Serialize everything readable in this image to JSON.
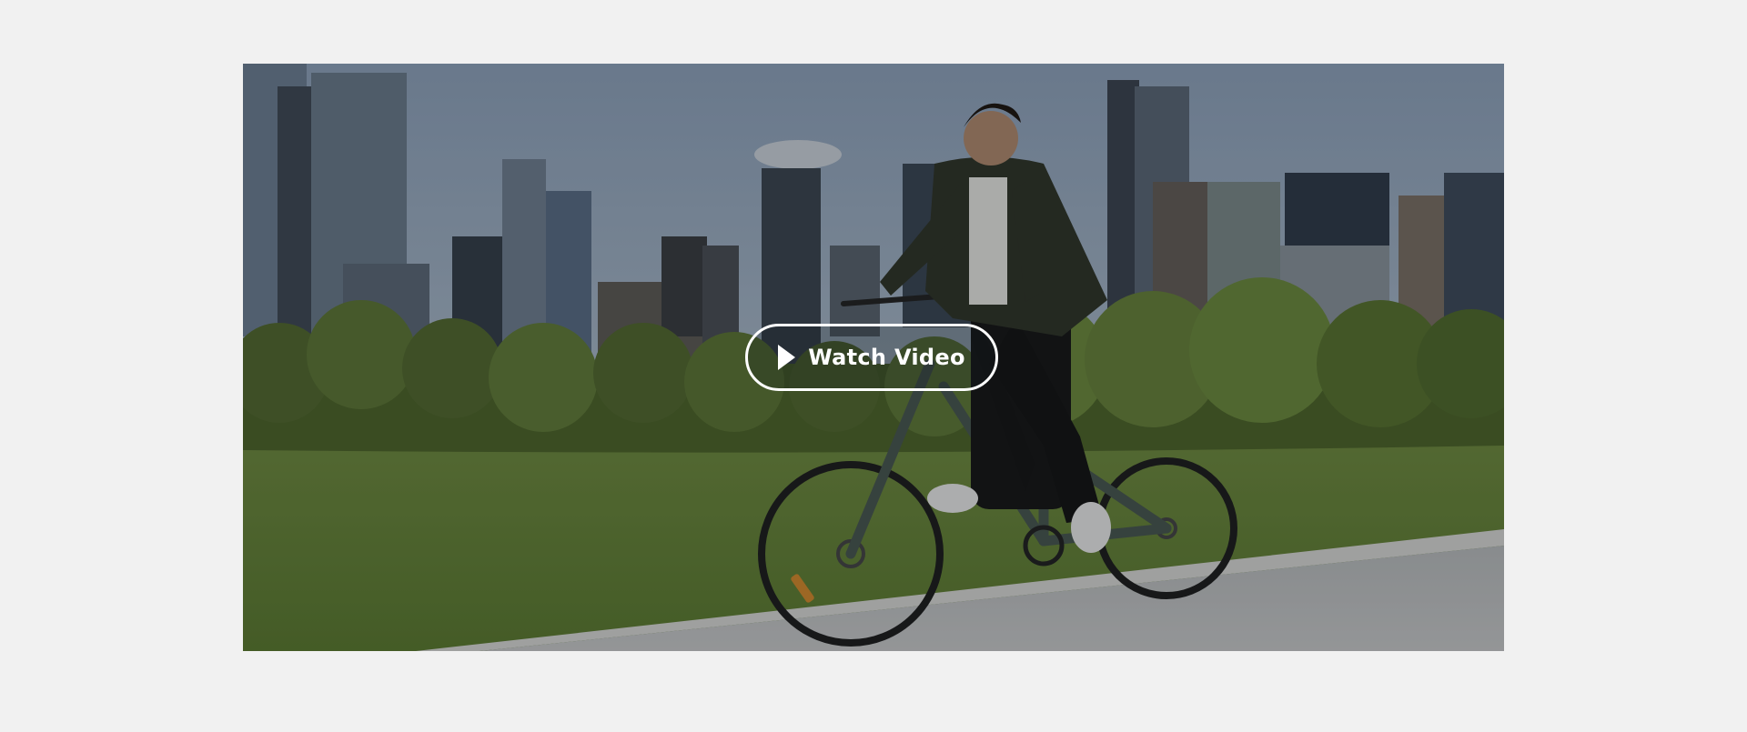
{
  "video": {
    "button_label": "Watch Video",
    "play_icon": "play-icon"
  },
  "colors": {
    "page_background": "#f1f1f1",
    "button_border": "#ffffff",
    "button_text": "#ffffff"
  }
}
